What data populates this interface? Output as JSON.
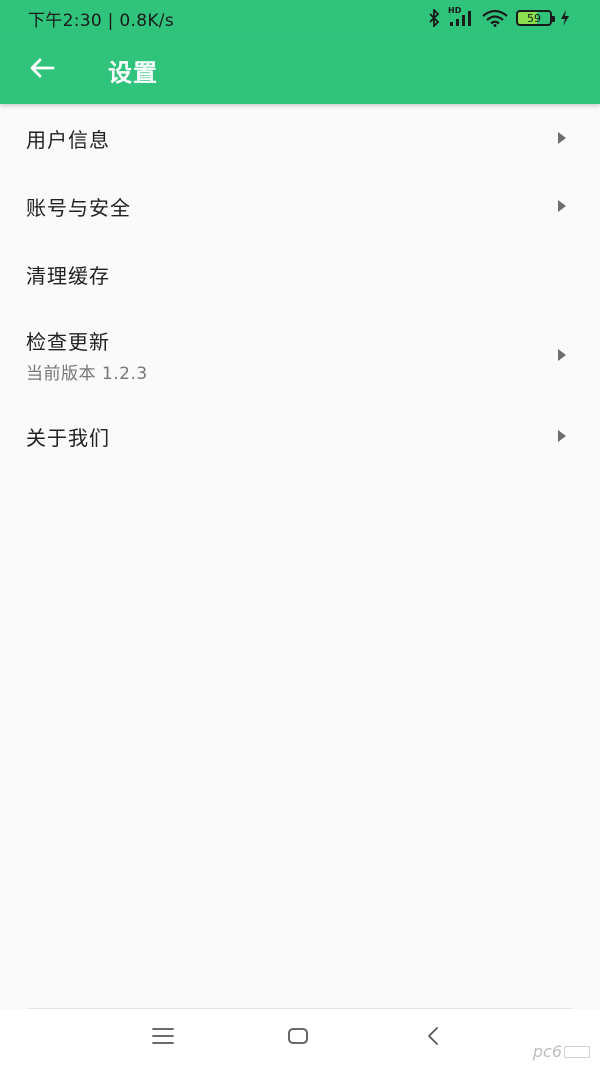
{
  "status_bar": {
    "time_speed": "下午2:30 | 0.8K/s",
    "hd_label": "HD",
    "battery_level": "59",
    "battery_fraction": 0.59
  },
  "app_bar": {
    "title": "设置",
    "back_icon": "arrow-left-icon",
    "background_color": "#30c37c"
  },
  "settings": {
    "items": [
      {
        "label": "用户信息",
        "has_chevron": true
      },
      {
        "label": "账号与安全",
        "has_chevron": true
      },
      {
        "label": "清理缓存",
        "has_chevron": false
      },
      {
        "label": "检查更新",
        "sub": "当前版本 1.2.3",
        "has_chevron": true
      },
      {
        "label": "关于我们",
        "has_chevron": true
      }
    ]
  },
  "nav_bar": {
    "menu_icon": "menu-icon",
    "home_icon": "home-icon",
    "back_icon": "back-chevron-icon"
  },
  "watermark": {
    "text": "pc6"
  }
}
